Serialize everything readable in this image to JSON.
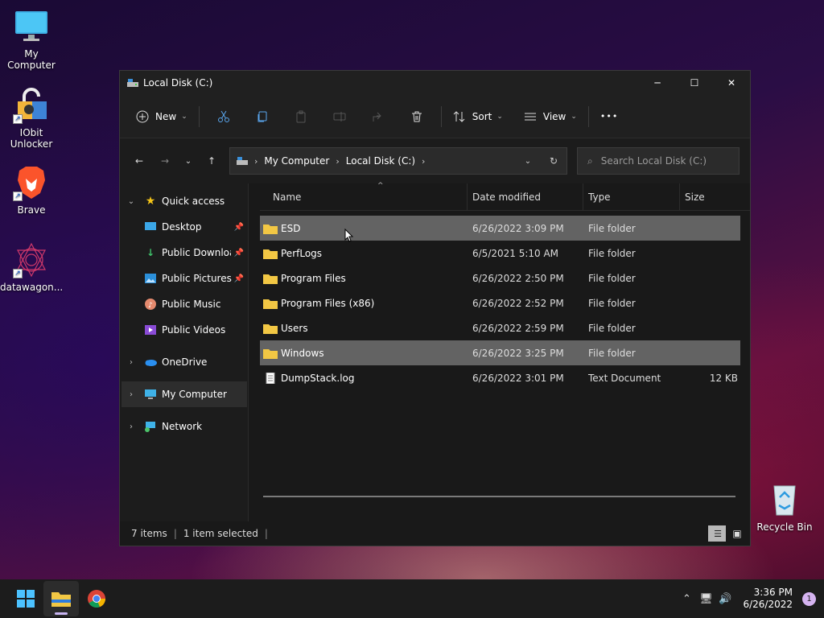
{
  "desktop": {
    "icons": [
      {
        "label": "My Computer"
      },
      {
        "label": "IObit Unlocker"
      },
      {
        "label": "Brave"
      },
      {
        "label": "datawagon..."
      },
      {
        "label": "Recycle Bin"
      }
    ]
  },
  "window": {
    "title": "Local Disk (C:)",
    "controls": {
      "minimize": "─",
      "maximize": "☐",
      "close": "✕"
    }
  },
  "commandbar": {
    "new_label": "New",
    "sort_label": "Sort",
    "view_label": "View",
    "more_label": "•••"
  },
  "address": {
    "crumbs": [
      "My Computer",
      "Local Disk (C:)"
    ],
    "search_placeholder": "Search Local Disk (C:)"
  },
  "navpane": {
    "quick_access": "Quick access",
    "items": [
      "Desktop",
      "Public Downloads",
      "Public Pictures",
      "Public Music",
      "Public Videos"
    ],
    "onedrive": "OneDrive",
    "my_computer": "My Computer",
    "network": "Network"
  },
  "columns": {
    "name": "Name",
    "date": "Date modified",
    "type": "Type",
    "size": "Size"
  },
  "files": [
    {
      "name": "ESD",
      "date": "6/26/2022 3:09 PM",
      "type": "File folder",
      "size": "",
      "kind": "folder"
    },
    {
      "name": "PerfLogs",
      "date": "6/5/2021 5:10 AM",
      "type": "File folder",
      "size": "",
      "kind": "folder"
    },
    {
      "name": "Program Files",
      "date": "6/26/2022 2:50 PM",
      "type": "File folder",
      "size": "",
      "kind": "folder"
    },
    {
      "name": "Program Files (x86)",
      "date": "6/26/2022 2:52 PM",
      "type": "File folder",
      "size": "",
      "kind": "folder"
    },
    {
      "name": "Users",
      "date": "6/26/2022 2:59 PM",
      "type": "File folder",
      "size": "",
      "kind": "folder"
    },
    {
      "name": "Windows",
      "date": "6/26/2022 3:25 PM",
      "type": "File folder",
      "size": "",
      "kind": "folder"
    },
    {
      "name": "DumpStack.log",
      "date": "6/26/2022 3:01 PM",
      "type": "Text Document",
      "size": "12 KB",
      "kind": "file"
    }
  ],
  "status": {
    "count": "7 items",
    "selected": "1 item selected"
  },
  "taskbar": {
    "time": "3:36 PM",
    "date": "6/26/2022",
    "notifications": "1"
  },
  "colors": {
    "folder": "#f2c744",
    "selection": "#636363",
    "accent": "#0078d4"
  }
}
